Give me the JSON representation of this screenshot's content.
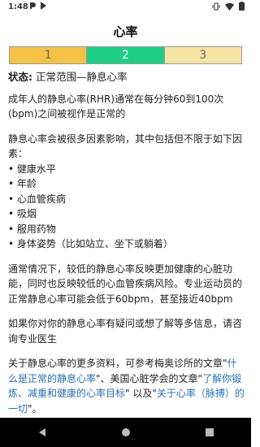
{
  "statusbar": {
    "time": "1:48"
  },
  "header": {
    "title": "心率"
  },
  "levels": [
    {
      "label": "1",
      "color": "#f3c247"
    },
    {
      "label": "2",
      "color": "#1fcf86"
    },
    {
      "label": "3",
      "color": "#f6e4a4"
    }
  ],
  "content": {
    "status_label": "状态:",
    "status_value": " 正常范围—静息心率",
    "p1": "成年人的静息心率(RHR)通常在每分钟60到100次(bpm)之间被视作是正常的",
    "p2": "静息心率会被很多因素影响，其中包括但不限于如下因素：",
    "factors": [
      "健康水平",
      "年龄",
      "心血管疾病",
      "吸烟",
      "服用药物",
      "身体姿势（比如站立、坐下或躺着）"
    ],
    "p3": "通常情况下，较低的静息心率反映更加健康的心脏功能，同时也反映较低的心血管疾病风险。专业运动员的正常静息心率可能会低于60bpm，甚至接近40bpm",
    "p4": "如果你对你的静息心率有疑问或想了解等多信息，请咨询专业医生",
    "refs_pre": "关于静息心率的更多资料，可参考梅奥诊所的文章\"",
    "ref1": "什么是正常的静息心率",
    "refs_mid1": "\"、美国心脏学会的文章\"",
    "ref2": "了解你锻炼、减重和健康的心率目标",
    "refs_mid2": "\" 以及\"",
    "ref3": "关于心率（脉搏）的一切",
    "refs_end": "\"。"
  }
}
